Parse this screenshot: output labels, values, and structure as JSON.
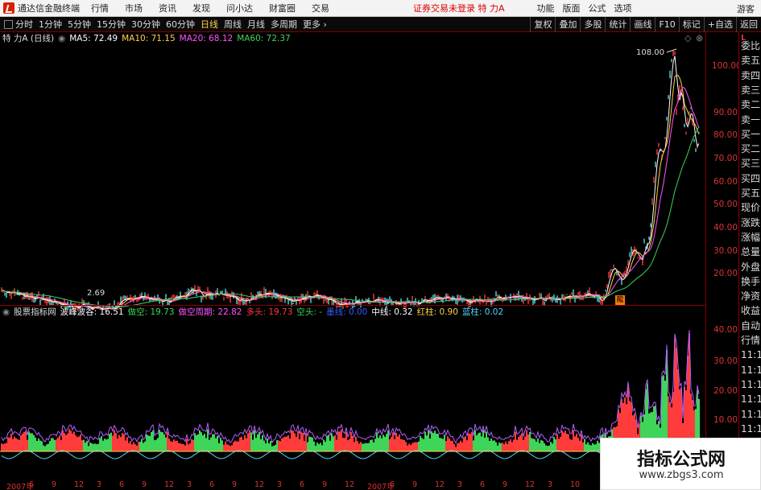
{
  "titlebar": {
    "app_title": "通达信金融终端",
    "menu": [
      "行情",
      "市场",
      "资讯",
      "发现",
      "问小达",
      "财富圈",
      "交易"
    ],
    "login_status": "证券交易未登录",
    "stock_name_top": "特 力A",
    "right_menu": [
      "功能",
      "版面",
      "公式",
      "选项"
    ],
    "user": "游客"
  },
  "toolbar": {
    "periods": [
      "分时",
      "1分钟",
      "5分钟",
      "15分钟",
      "30分钟",
      "60分钟",
      "日线",
      "周线",
      "月线",
      "多周期",
      "更多"
    ],
    "active_period": "日线",
    "right_buttons": [
      "复权",
      "叠加",
      "多股",
      "统计",
      "画线",
      "F10",
      "标记",
      "+自选",
      "返回"
    ]
  },
  "main_info": {
    "stock": "特 力A (日线)",
    "ma5": "MA5: 72.49",
    "ma10": "MA10: 71.15",
    "ma20": "MA20: 68.12",
    "ma60": "MA60: 72.37"
  },
  "price_axis": [
    "100.00",
    "90.00",
    "80.00",
    "70.00",
    "60.00",
    "50.00",
    "40.00",
    "30.00",
    "20.00"
  ],
  "annotations": {
    "high": "108.00",
    "low": "2.69",
    "flag": "龍"
  },
  "indicator_info": {
    "name": "股票指标网",
    "bofeng": "波峰波谷: 16.51",
    "duokong": "做空: 19.73",
    "duokong_zq": "做空周期: 22.82",
    "duotou": "多头: 19.73",
    "kongtou": "空头: -",
    "zhixian": "墨线: 0.00",
    "zhongxian": "中线: 0.32",
    "hongzhu": "红柱: 0.90",
    "lanzhu": "蓝柱: 0.02"
  },
  "indicator_axis": [
    "40.00",
    "30.00",
    "20.00",
    "10.00"
  ],
  "date_axis": [
    "2007年",
    "6",
    "9",
    "12",
    "3",
    "6",
    "9",
    "12",
    "3",
    "6",
    "9",
    "12",
    "3",
    "6",
    "9",
    "12",
    "2007年",
    "6",
    "9",
    "12",
    "3",
    "6",
    "9",
    "12",
    "3",
    "10"
  ],
  "right_panel": {
    "label_top": "L",
    "items": [
      "委比",
      "卖五",
      "卖四",
      "卖三",
      "卖二",
      "卖一",
      "买一",
      "买二",
      "买三",
      "买四",
      "买五",
      "现价",
      "涨跌",
      "涨幅",
      "总量",
      "外盘",
      "换手",
      "净资",
      "收益",
      "自动",
      "行情",
      "11:1",
      "11:1",
      "11:1",
      "11:1",
      "11:1",
      "11:1",
      "11:1",
      "11:1"
    ]
  },
  "watermark": {
    "cn": "指标公式网",
    "url": "www.zbgs3.com"
  },
  "colors": {
    "up": "#ff3b3b",
    "down": "#3fd45a",
    "ma5": "#ffffff",
    "ma10": "#ffd24a",
    "ma20": "#ff55ff",
    "ma60": "#3fd45a"
  }
}
